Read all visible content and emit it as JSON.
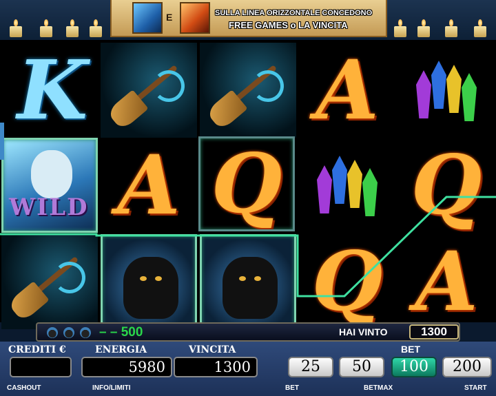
{
  "banner": {
    "conjunction": "E",
    "line1": "SULLA LINEA ORIZZONTALE CONCEDONO",
    "line2": "FREE GAMES o LA VINCITA"
  },
  "reels": {
    "letters": {
      "k": "K",
      "a": "A",
      "q": "Q"
    },
    "wild_label": "WILD"
  },
  "win_bar": {
    "combo": "– – 500",
    "label": "HAI VINTO",
    "value": "1300"
  },
  "panel": {
    "credits_label": "CREDITI €",
    "credits_value": "",
    "energy_label": "ENERGIA",
    "energy_value": "5980",
    "win_label": "VINCITA",
    "win_value": "1300",
    "bet_label": "BET",
    "bet_options": [
      "25",
      "50",
      "100",
      "200"
    ],
    "selected_bet": "100"
  },
  "bottom_buttons": {
    "cashout": "CASHOUT",
    "info": "INFO/LIMITI",
    "bet": "BET",
    "betmax": "BETMAX",
    "start": "START"
  },
  "colors": {
    "winline": "#3fe0a0",
    "frame": "#7fd4b0",
    "selected_bet": "#1fb58c",
    "win_combo": "#2ad64a"
  }
}
